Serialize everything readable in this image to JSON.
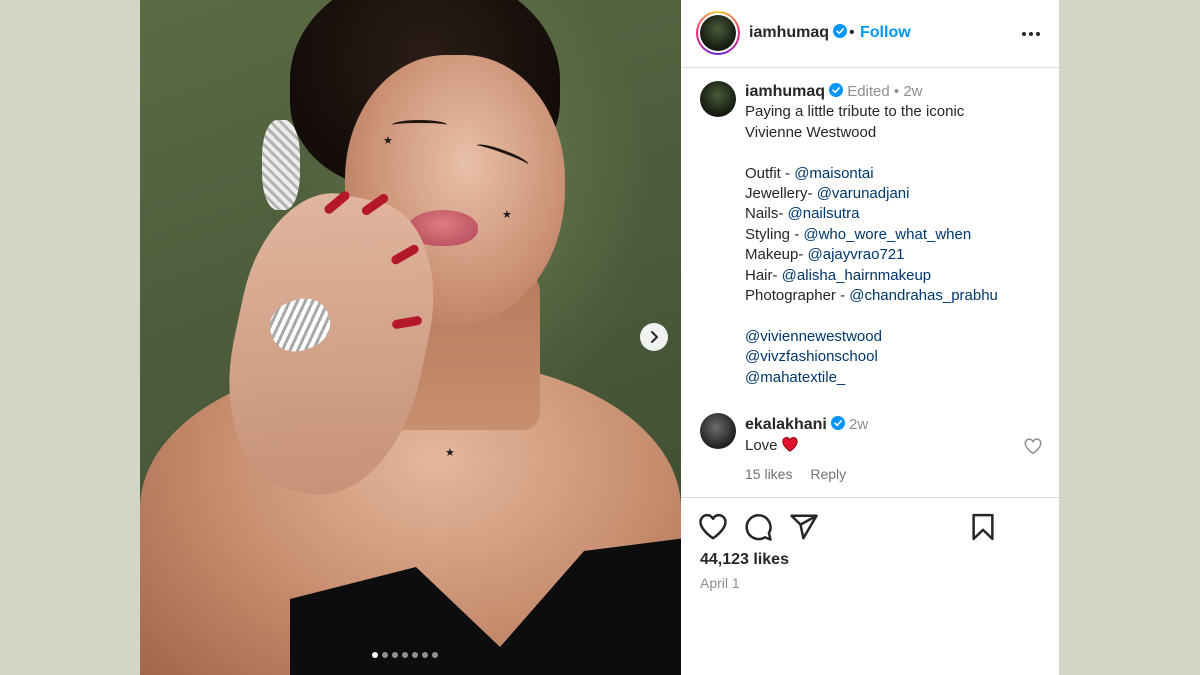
{
  "post": {
    "username": "iamhumaq",
    "separator": "•",
    "follow_label": "Follow",
    "photo": {
      "slide_count": 7,
      "active_slide": 1
    }
  },
  "caption": {
    "username": "iamhumaq",
    "edited": "Edited",
    "bullet": "•",
    "age": "2w",
    "lines": [
      [
        {
          "t": "Paying a little tribute to the iconic"
        }
      ],
      [
        {
          "t": "Vivienne Westwood"
        }
      ],
      [],
      [
        {
          "t": "Outfit - "
        },
        {
          "t": "@maisontai",
          "m": true
        }
      ],
      [
        {
          "t": "Jewellery- "
        },
        {
          "t": "@varunadjani",
          "m": true
        }
      ],
      [
        {
          "t": "Nails- "
        },
        {
          "t": "@nailsutra",
          "m": true
        }
      ],
      [
        {
          "t": "Styling - "
        },
        {
          "t": "@who_wore_what_when",
          "m": true
        }
      ],
      [
        {
          "t": "Makeup- "
        },
        {
          "t": "@ajayvrao721",
          "m": true
        }
      ],
      [
        {
          "t": "Hair- "
        },
        {
          "t": "@alisha_hairnmakeup",
          "m": true
        }
      ],
      [
        {
          "t": "Photographer - "
        },
        {
          "t": "@chandrahas_prabhu",
          "m": true
        }
      ],
      [],
      [
        {
          "t": "@viviennewestwood",
          "m": true
        }
      ],
      [
        {
          "t": "@vivzfashionschool",
          "m": true
        }
      ],
      [
        {
          "t": "@mahatextile_",
          "m": true
        }
      ]
    ]
  },
  "comment": {
    "username": "ekalakhani",
    "age": "2w",
    "text": "Love",
    "likes": "15 likes",
    "reply": "Reply"
  },
  "footer": {
    "likes": "44,123 likes",
    "date": "April 1"
  },
  "colors": {
    "accent": "#0095f6",
    "mention": "#00376b",
    "verified": "#0095f6",
    "heart": "#ed4956"
  },
  "icons": [
    "more-icon",
    "verified-icon",
    "heart-icon",
    "comment-icon",
    "share-icon",
    "bookmark-icon",
    "chevron-right-icon"
  ]
}
